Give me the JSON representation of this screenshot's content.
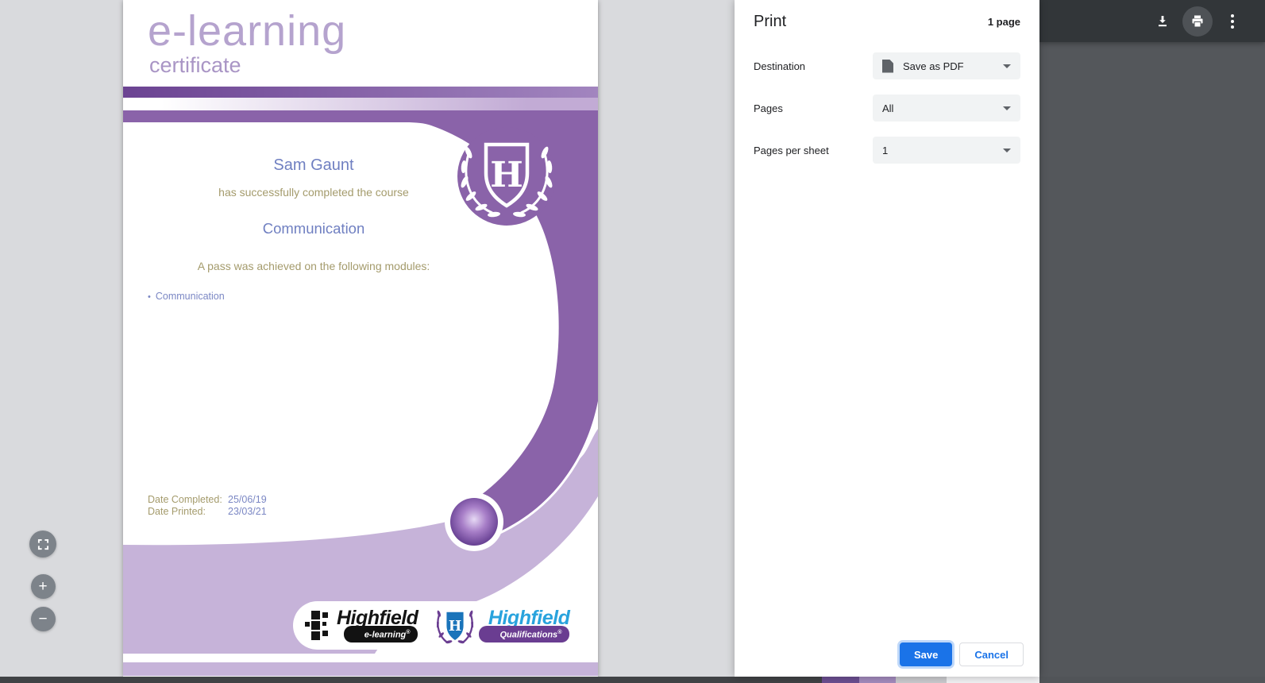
{
  "certificate": {
    "brand_title": "e-learning",
    "brand_subtitle": "certificate",
    "recipient": "Sam Gaunt",
    "completion_line": "has successfully completed the course",
    "course_title": "Communication",
    "pass_line": "A pass was achieved on the following modules:",
    "modules": [
      "Communication"
    ],
    "dates": [
      {
        "label": "Date Completed:",
        "value": "25/06/19"
      },
      {
        "label": "Date Printed:",
        "value": "23/03/21"
      }
    ],
    "crest_letter": "H",
    "footer_logos": {
      "elearning": {
        "name": "Highfield",
        "tagline": "e-learning",
        "trademark": "®"
      },
      "qualifications": {
        "name": "Highfield",
        "tagline": "Qualifications",
        "trademark": "®",
        "crest_letter": "H"
      }
    }
  },
  "print_dialog": {
    "title": "Print",
    "sheet_count": "1 page",
    "fields": [
      {
        "label": "Destination",
        "value": "Save as PDF",
        "icon": "pdf-file-icon"
      },
      {
        "label": "Pages",
        "value": "All"
      },
      {
        "label": "Pages per sheet",
        "value": "1"
      }
    ],
    "buttons": {
      "save": "Save",
      "cancel": "Cancel"
    }
  },
  "pdf_toolbar": {
    "icons": [
      "download-icon",
      "print-icon",
      "more-vertical-icon"
    ]
  },
  "zoom_controls": {
    "fit_icon": "fit-to-page-icon",
    "zoom_in_glyph": "+",
    "zoom_out_glyph": "−"
  },
  "colors": {
    "accent_blue": "#1a73e8",
    "brand_purple": "#8a63a9",
    "light_purple": "#c6b3d9",
    "toolbar_dark": "#323639",
    "qualifications_blue": "#29a3dd",
    "background_gray": "#d9dadd"
  }
}
